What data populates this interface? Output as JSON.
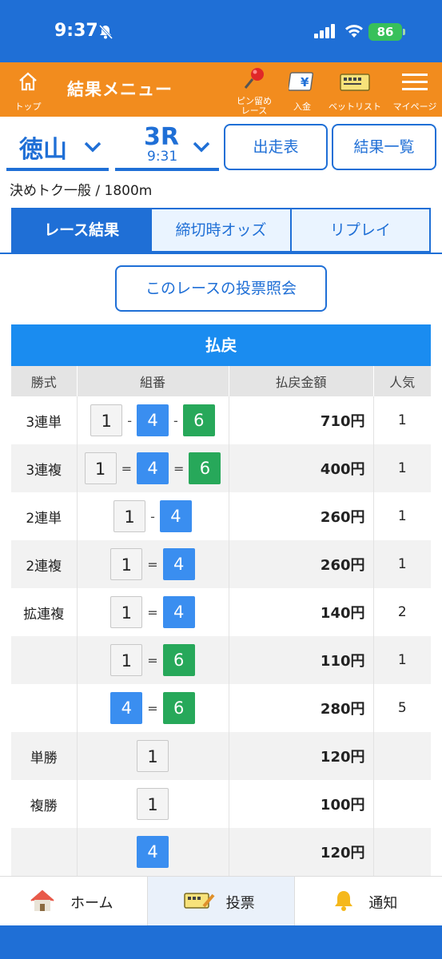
{
  "status": {
    "time": "9:37",
    "battery": "86"
  },
  "header": {
    "top_label": "トップ",
    "title": "結果メニュー",
    "pin_label_1": "ピン留め",
    "pin_label_2": "レース",
    "deposit_label": "入金",
    "betlist_label": "ベットリスト",
    "mypage_label": "マイページ"
  },
  "race": {
    "venue": "徳山",
    "race_no": "3R",
    "race_time": "9:31",
    "entry_button": "出走表",
    "results_button": "結果一覧",
    "info": "決めトク一般 / 1800m"
  },
  "tabs": [
    "レース結果",
    "締切時オッズ",
    "リプレイ"
  ],
  "vote_button": "このレースの投票照会",
  "payout": {
    "title": "払戻",
    "headers": [
      "勝式",
      "組番",
      "払戻金額",
      "人気"
    ],
    "rows": [
      {
        "type": "3連単",
        "combo": [
          "1",
          "4",
          "6"
        ],
        "sep": "-",
        "amount": "710円",
        "pop": "1"
      },
      {
        "type": "3連複",
        "combo": [
          "1",
          "4",
          "6"
        ],
        "sep": "=",
        "amount": "400円",
        "pop": "1"
      },
      {
        "type": "2連単",
        "combo": [
          "1",
          "4"
        ],
        "sep": "-",
        "amount": "260円",
        "pop": "1"
      },
      {
        "type": "2連複",
        "combo": [
          "1",
          "4"
        ],
        "sep": "=",
        "amount": "260円",
        "pop": "1"
      },
      {
        "type": "拡連複",
        "combo": [
          "1",
          "4"
        ],
        "sep": "=",
        "amount": "140円",
        "pop": "2"
      },
      {
        "type": "",
        "combo": [
          "1",
          "6"
        ],
        "sep": "=",
        "amount": "110円",
        "pop": "1"
      },
      {
        "type": "",
        "combo": [
          "4",
          "6"
        ],
        "sep": "=",
        "amount": "280円",
        "pop": "5"
      },
      {
        "type": "単勝",
        "combo": [
          "1"
        ],
        "sep": "",
        "amount": "120円",
        "pop": ""
      },
      {
        "type": "複勝",
        "combo": [
          "1"
        ],
        "sep": "",
        "amount": "100円",
        "pop": ""
      },
      {
        "type": "",
        "combo": [
          "4"
        ],
        "sep": "",
        "amount": "120円",
        "pop": ""
      }
    ],
    "boat_colors": {
      "1": "#f4f4f4",
      "4": "#3a8ef0",
      "6": "#27a85a"
    }
  },
  "bottom_nav": [
    "ホーム",
    "投票",
    "通知"
  ],
  "colors": {
    "brand_blue": "#1f6fd6",
    "header_orange": "#f28c1e",
    "table_blue": "#1a8cf0"
  }
}
